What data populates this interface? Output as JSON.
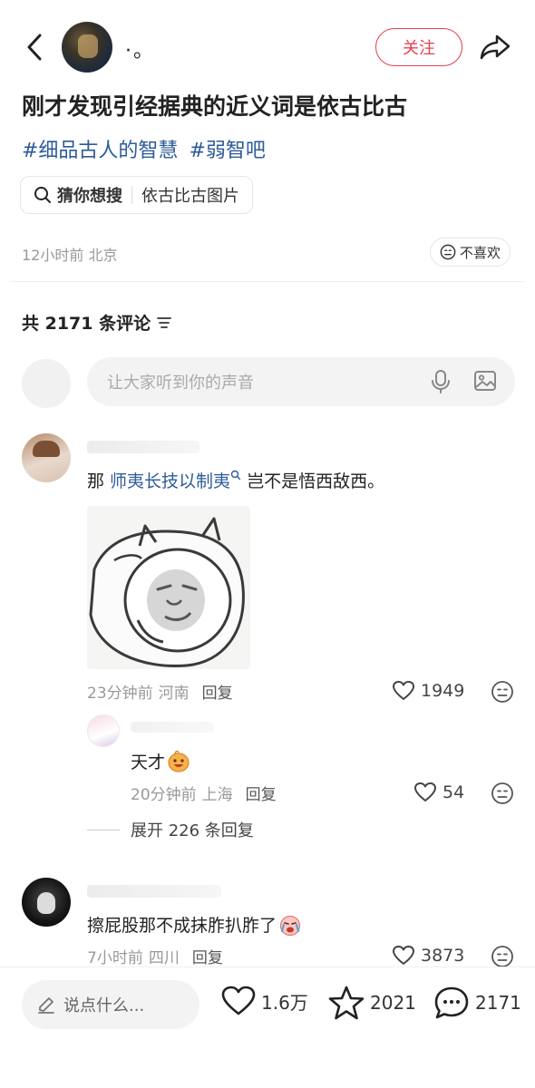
{
  "header": {
    "author_name": "·。",
    "follow_label": "关注"
  },
  "post": {
    "title": "刚才发现引经据典的近义词是依古比古",
    "tags": [
      "#细品古人的智慧",
      "#弱智吧"
    ],
    "search_chip": {
      "prefix": "猜你想搜",
      "query": "依古比古图片"
    },
    "time_location": "12小时前 北京",
    "dislike_label": "不喜欢"
  },
  "comments_section": {
    "count_label": "共 2171 条评论",
    "input_placeholder": "让大家听到你的声音"
  },
  "comments": [
    {
      "text_before": "那 ",
      "link_text": "师夷长技以制夷",
      "text_after": " 岂不是悟西敌西。",
      "time": "23分钟前",
      "location": "河南",
      "reply_label": "回复",
      "likes": "1949"
    },
    {
      "text": "天才",
      "time": "20分钟前",
      "location": "上海",
      "reply_label": "回复",
      "likes": "54"
    },
    {
      "text": "擦屁股那不成抹胙扒胙了",
      "time": "7小时前",
      "location": "四川",
      "reply_label": "回复",
      "likes": "3873"
    }
  ],
  "expand_label": "展开 226 条回复",
  "bottom_bar": {
    "say_placeholder": "说点什么...",
    "likes": "1.6万",
    "stars": "2021",
    "comments": "2171"
  },
  "colors": {
    "accent": "#e5404f",
    "link": "#2d5b9a",
    "muted": "#999999"
  }
}
